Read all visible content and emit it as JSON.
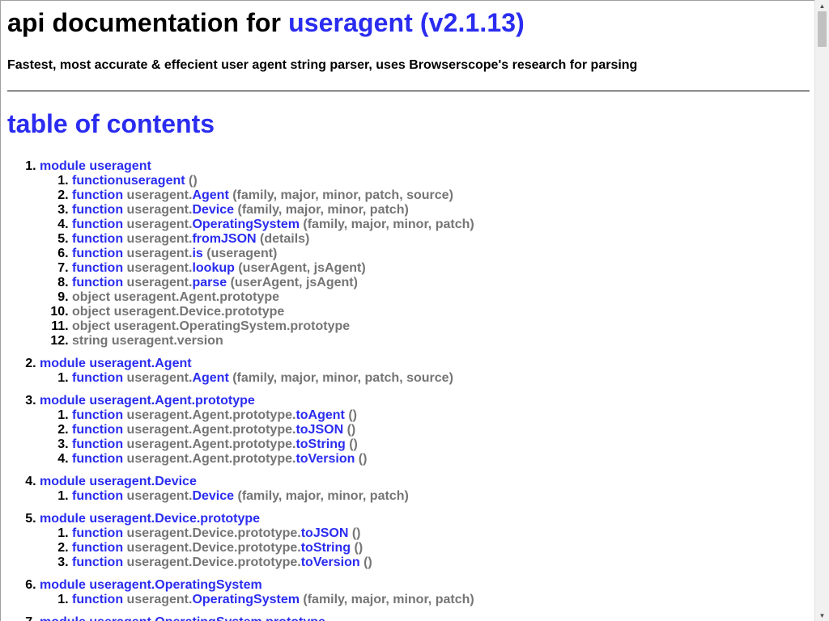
{
  "header": {
    "title_prefix": "api documentation for ",
    "title_link": "useragent (v2.1.13)",
    "tagline": "Fastest, most accurate & effecient user agent string parser, uses Browserscope's research for parsing"
  },
  "toc": {
    "heading": "table of contents",
    "sections": [
      {
        "label": "module useragent",
        "items": [
          {
            "kw": "function",
            "prefix": "",
            "name": "useragent",
            "args": " ()"
          },
          {
            "kw": "function",
            "prefix": " useragent.",
            "name": "Agent",
            "args": " (family, major, minor, patch, source)"
          },
          {
            "kw": "function",
            "prefix": " useragent.",
            "name": "Device",
            "args": " (family, major, minor, patch)"
          },
          {
            "kw": "function",
            "prefix": " useragent.",
            "name": "OperatingSystem",
            "args": " (family, major, minor, patch)"
          },
          {
            "kw": "function",
            "prefix": " useragent.",
            "name": "fromJSON",
            "args": " (details)"
          },
          {
            "kw": "function",
            "prefix": " useragent.",
            "name": "is",
            "args": " (useragent)"
          },
          {
            "kw": "function",
            "prefix": " useragent.",
            "name": "lookup",
            "args": " (userAgent, jsAgent)"
          },
          {
            "kw": "function",
            "prefix": " useragent.",
            "name": "parse",
            "args": " (userAgent, jsAgent)"
          },
          {
            "plain": "object useragent.Agent.prototype"
          },
          {
            "plain": "object useragent.Device.prototype"
          },
          {
            "plain": "object useragent.OperatingSystem.prototype"
          },
          {
            "plain": "string useragent.version"
          }
        ]
      },
      {
        "label": "module useragent.Agent",
        "items": [
          {
            "kw": "function",
            "prefix": " useragent.",
            "name": "Agent",
            "args": " (family, major, minor, patch, source)"
          }
        ]
      },
      {
        "label": "module useragent.Agent.prototype",
        "items": [
          {
            "kw": "function",
            "prefix": " useragent.Agent.prototype.",
            "name": "toAgent",
            "args": " ()"
          },
          {
            "kw": "function",
            "prefix": " useragent.Agent.prototype.",
            "name": "toJSON",
            "args": " ()"
          },
          {
            "kw": "function",
            "prefix": " useragent.Agent.prototype.",
            "name": "toString",
            "args": " ()"
          },
          {
            "kw": "function",
            "prefix": " useragent.Agent.prototype.",
            "name": "toVersion",
            "args": " ()"
          }
        ]
      },
      {
        "label": "module useragent.Device",
        "items": [
          {
            "kw": "function",
            "prefix": " useragent.",
            "name": "Device",
            "args": " (family, major, minor, patch)"
          }
        ]
      },
      {
        "label": "module useragent.Device.prototype",
        "items": [
          {
            "kw": "function",
            "prefix": " useragent.Device.prototype.",
            "name": "toJSON",
            "args": " ()"
          },
          {
            "kw": "function",
            "prefix": " useragent.Device.prototype.",
            "name": "toString",
            "args": " ()"
          },
          {
            "kw": "function",
            "prefix": " useragent.Device.prototype.",
            "name": "toVersion",
            "args": " ()"
          }
        ]
      },
      {
        "label": "module useragent.OperatingSystem",
        "items": [
          {
            "kw": "function",
            "prefix": " useragent.",
            "name": "OperatingSystem",
            "args": " (family, major, minor, patch)"
          }
        ]
      },
      {
        "label": "module useragent.OperatingSystem.prototype",
        "items": []
      }
    ]
  },
  "colors": {
    "link": "#2a2cf0",
    "muted": "#757575",
    "text": "#000000"
  },
  "scrollbar": {
    "up_icon": "triangle-up",
    "down_icon": "triangle-down"
  }
}
